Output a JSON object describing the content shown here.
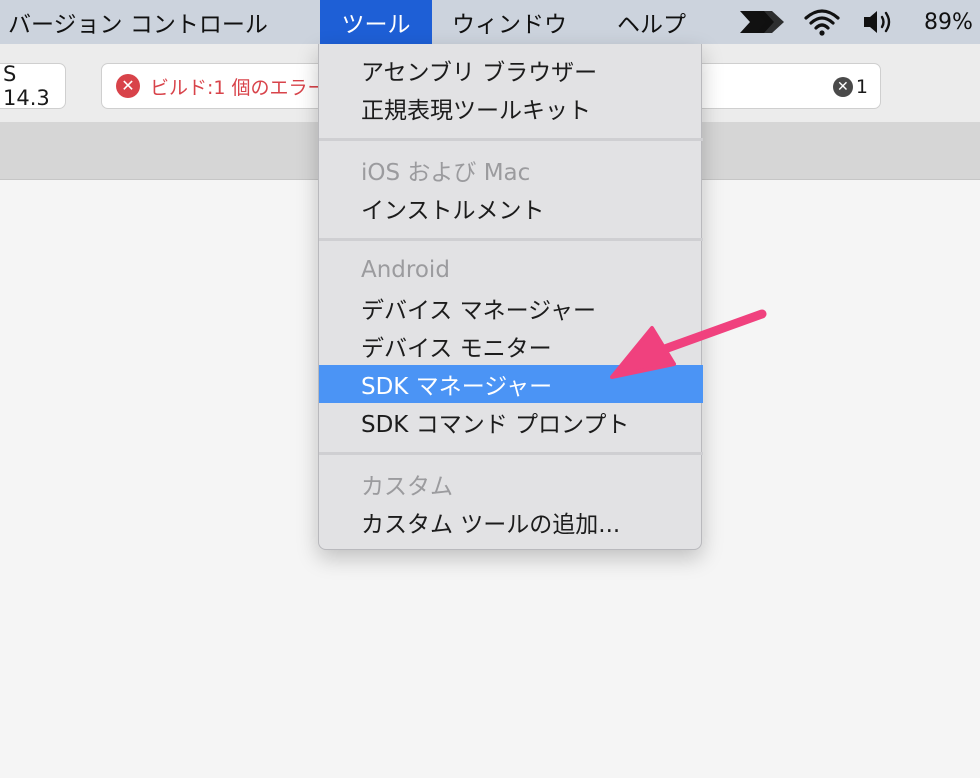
{
  "menubar": {
    "items": [
      {
        "label": "バージョン コントロール"
      },
      {
        "label": "ツール"
      },
      {
        "label": "ウィンドウ"
      },
      {
        "label": "ヘルプ"
      }
    ],
    "battery": "89%"
  },
  "toolbar": {
    "scheme_fragment": "S 14.3",
    "build_status": "ビルド:1 個のエラー",
    "error_count": "1"
  },
  "tools_menu": {
    "sections": [
      {
        "header": "",
        "items": [
          "アセンブリ ブラウザー",
          "正規表現ツールキット"
        ]
      },
      {
        "header": "iOS および Mac",
        "items": [
          "インストルメント"
        ]
      },
      {
        "header": "Android",
        "items": [
          "デバイス マネージャー",
          "デバイス モニター",
          "SDK マネージャー",
          "SDK コマンド プロンプト"
        ]
      },
      {
        "header": "カスタム",
        "items": [
          "カスタム ツールの追加..."
        ]
      }
    ],
    "selected_item": "SDK マネージャー"
  },
  "colors": {
    "menubar_bg": "#ccd3dd",
    "active_menu": "#1e5fd6",
    "selection": "#4b94f5",
    "error_red": "#d8434a",
    "arrow_pink": "#f0417e"
  }
}
